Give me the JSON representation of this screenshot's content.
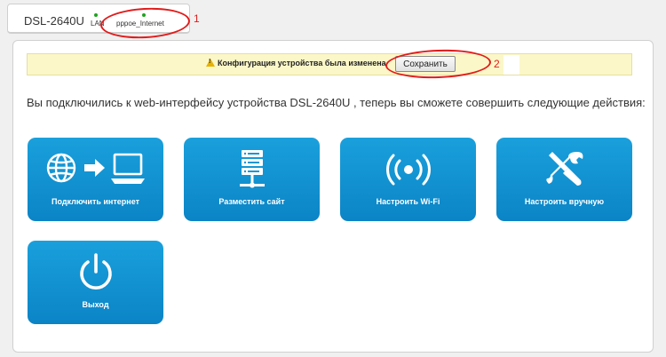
{
  "device": {
    "name": "DSL-2640U",
    "ports": [
      "LAN",
      "pppoe_Internet"
    ]
  },
  "annotations": {
    "label1": "1",
    "label2": "2"
  },
  "notification": {
    "text": "Конфигурация устройства была изменена",
    "save_label": "Сохранить"
  },
  "intro": "Вы подключились к web-интерфейсу устройства DSL-2640U , теперь вы сможете совершить следующие действия:",
  "tiles": [
    {
      "label": "Подключить интернет",
      "icon": "globe-computer-icon"
    },
    {
      "label": "Разместить сайт",
      "icon": "server-icon"
    },
    {
      "label": "Настроить Wi-Fi",
      "icon": "wifi-icon"
    },
    {
      "label": "Настроить вручную",
      "icon": "tools-icon"
    },
    {
      "label": "Выход",
      "icon": "power-icon"
    }
  ],
  "colors": {
    "tile": "#0f8fd1",
    "annotation": "#e11b1b",
    "notify_bg": "#fbf7c8",
    "link_dot": "#1fa21f"
  }
}
